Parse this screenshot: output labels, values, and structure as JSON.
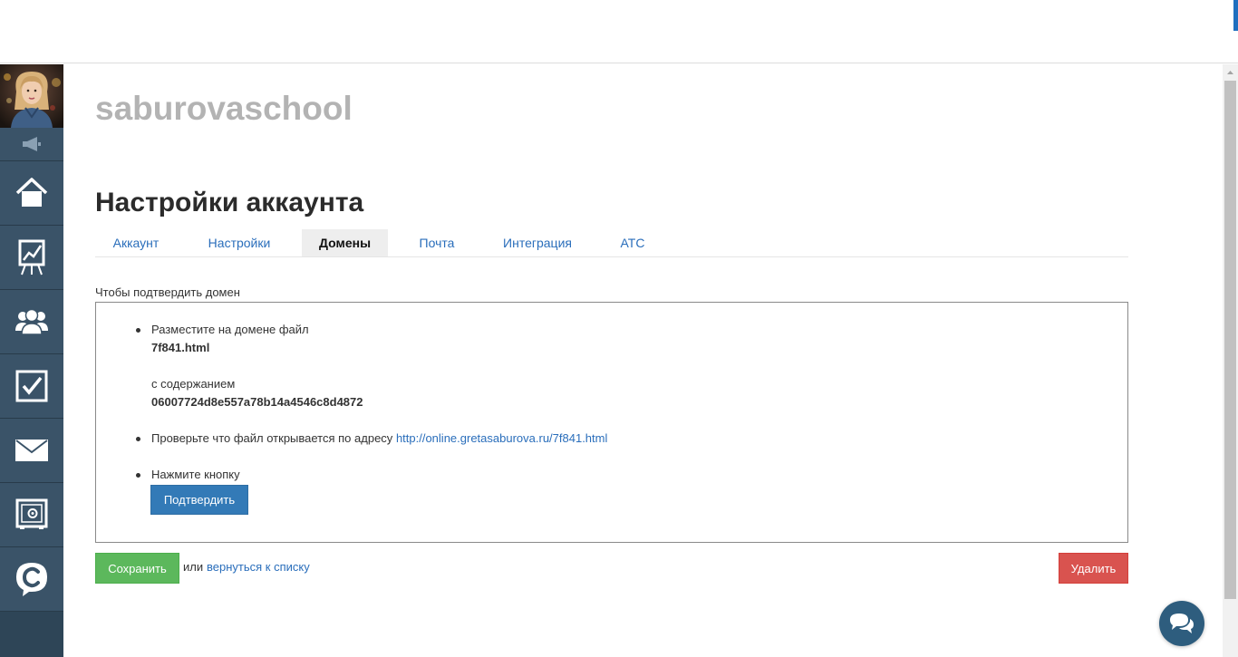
{
  "sidebar": {
    "items": [
      {
        "name": "home",
        "icon": "home-icon"
      },
      {
        "name": "analytics",
        "icon": "chart-board-icon"
      },
      {
        "name": "users",
        "icon": "users-icon"
      },
      {
        "name": "tasks",
        "icon": "checkbox-icon"
      },
      {
        "name": "messages",
        "icon": "envelope-icon"
      },
      {
        "name": "safe",
        "icon": "safe-icon"
      },
      {
        "name": "chat",
        "icon": "speech-c-icon"
      }
    ]
  },
  "header": {
    "account_name": "saburovaschool",
    "page_title": "Настройки аккаунта"
  },
  "tabs": [
    {
      "label": "Аккаунт",
      "active": false
    },
    {
      "label": "Настройки",
      "active": false
    },
    {
      "label": "Домены",
      "active": true
    },
    {
      "label": "Почта",
      "active": false
    },
    {
      "label": "Интеграция",
      "active": false
    },
    {
      "label": "АТС",
      "active": false
    }
  ],
  "domain": {
    "section_label": "Чтобы подтвердить домен",
    "step1_text": "Разместите на домене файл",
    "file_name": "7f841.html",
    "content_label": "с содержанием",
    "content_value": "06007724d8e557a78b14a4546c8d4872",
    "step2_text": "Проверьте что файл открывается по адресу",
    "check_url": "http://online.gretasaburova.ru/7f841.html",
    "step3_text": "Нажмите кнопку",
    "confirm_label": "Подтвердить"
  },
  "actions": {
    "save_label": "Сохранить",
    "or_text": "или",
    "back_link": "вернуться к списку",
    "delete_label": "Удалить"
  },
  "colors": {
    "sidebar_bg": "#2e4557",
    "link": "#2a6ebb",
    "primary": "#337ab7",
    "success": "#5cb85c",
    "danger": "#d9534f",
    "chat_widget": "#2e5d7e"
  },
  "chat_widget_icon": "chat-bubbles-icon"
}
